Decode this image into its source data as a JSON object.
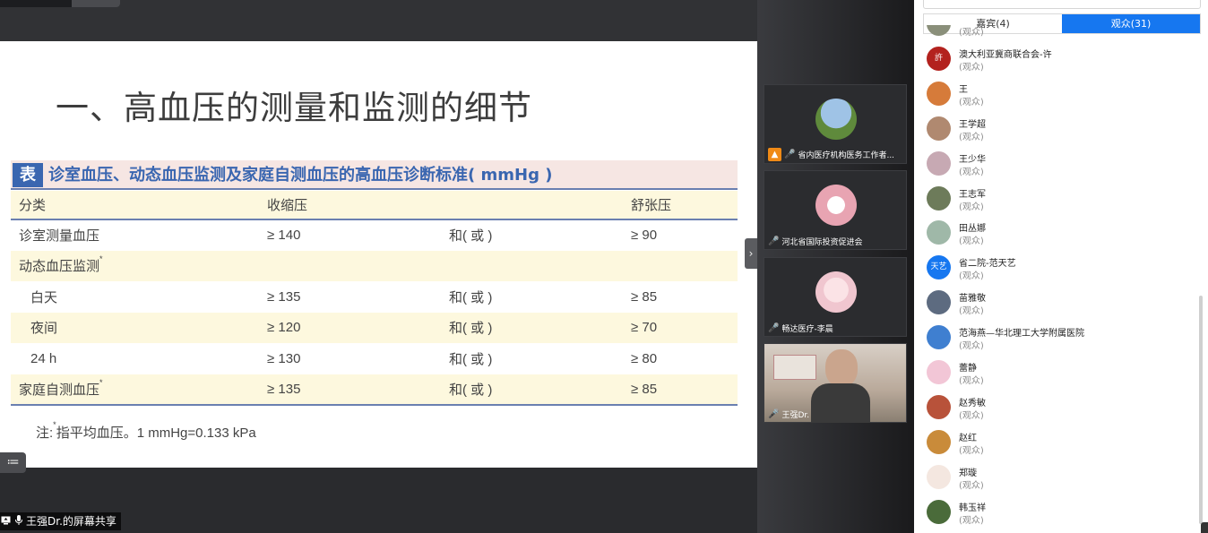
{
  "share": {
    "slide_title": "一、高血压的测量和监测的细节",
    "table_badge": "表 1",
    "table_caption": "诊室血压、动态血压监测及家庭自测血压的高血压诊断标准( mmHg )",
    "columns": [
      "分类",
      "收缩压",
      "",
      "舒张压"
    ],
    "rows": [
      {
        "cat": "诊室测量血压",
        "star": "",
        "sys": "≥ 140",
        "conj": "和( 或 )",
        "dia": "≥ 90"
      },
      {
        "cat": "动态血压监测",
        "star": "*",
        "sys": "",
        "conj": "",
        "dia": ""
      },
      {
        "cat": "白天",
        "star": "",
        "sys": "≥ 135",
        "conj": "和( 或 )",
        "dia": "≥ 85"
      },
      {
        "cat": "夜间",
        "star": "",
        "sys": "≥ 120",
        "conj": "和( 或 )",
        "dia": "≥ 70"
      },
      {
        "cat": "24 h",
        "star": "",
        "sys": "≥ 130",
        "conj": "和( 或 )",
        "dia": "≥ 80"
      },
      {
        "cat": "家庭自测血压",
        "star": "*",
        "sys": "≥ 135",
        "conj": "和( 或 )",
        "dia": "≥ 85"
      }
    ],
    "note_prefix": "注:",
    "note_star": "*",
    "note_text": "指平均血压。1 mmHg=0.133 kPa",
    "list_toggle_icon": "≔",
    "share_label": "王强Dr.的屏幕共享"
  },
  "videos": [
    {
      "name": "省内医疗机构医务工作者...",
      "avatar_color": "#6f9fc7",
      "has_badge": true
    },
    {
      "name": "河北省国际投资促进会",
      "avatar_color": "#e8a4b2",
      "has_badge": false
    },
    {
      "name": "畅达医疗-李晨",
      "avatar_color": "#f0c6cf",
      "has_badge": false
    },
    {
      "name": "王强Dr.",
      "avatar_color": "#c9b9a8",
      "has_badge": false
    }
  ],
  "panel": {
    "tab_guests": "嘉宾(4)",
    "tab_audience": "观众(31)",
    "participants": [
      {
        "name": "",
        "role": "(观众)",
        "avatar": "#8a8f7a",
        "avatar_text": ""
      },
      {
        "name": "澳大利亚冀商联合会-许",
        "role": "(观众)",
        "avatar": "#b3221e",
        "avatar_text": "許"
      },
      {
        "name": "王",
        "role": "(观众)",
        "avatar": "#d67b3a",
        "avatar_text": ""
      },
      {
        "name": "王学超",
        "role": "(观众)",
        "avatar": "#b08970",
        "avatar_text": ""
      },
      {
        "name": "王少华",
        "role": "(观众)",
        "avatar": "#c7a9b3",
        "avatar_text": ""
      },
      {
        "name": "王志军",
        "role": "(观众)",
        "avatar": "#6d7b5a",
        "avatar_text": ""
      },
      {
        "name": "田丛娜",
        "role": "(观众)",
        "avatar": "#9fb8a8",
        "avatar_text": ""
      },
      {
        "name": "省二院-范天艺",
        "role": "(观众)",
        "avatar": "#1677f0",
        "avatar_text": "天艺"
      },
      {
        "name": "苗雅敬",
        "role": "(观众)",
        "avatar": "#5d6b80",
        "avatar_text": ""
      },
      {
        "name": "范海燕—华北理工大学附属医院",
        "role": "(观众)",
        "avatar": "#3f7fd0",
        "avatar_text": ""
      },
      {
        "name": "蕾静",
        "role": "(观众)",
        "avatar": "#f2c6d6",
        "avatar_text": ""
      },
      {
        "name": "赵秀敏",
        "role": "(观众)",
        "avatar": "#b8523a",
        "avatar_text": ""
      },
      {
        "name": "赵红",
        "role": "(观众)",
        "avatar": "#c98b3a",
        "avatar_text": ""
      },
      {
        "name": "郑璇",
        "role": "(观众)",
        "avatar": "#f4e7e0",
        "avatar_text": ""
      },
      {
        "name": "韩玉祥",
        "role": "(观众)",
        "avatar": "#4a6b3a",
        "avatar_text": ""
      }
    ]
  }
}
